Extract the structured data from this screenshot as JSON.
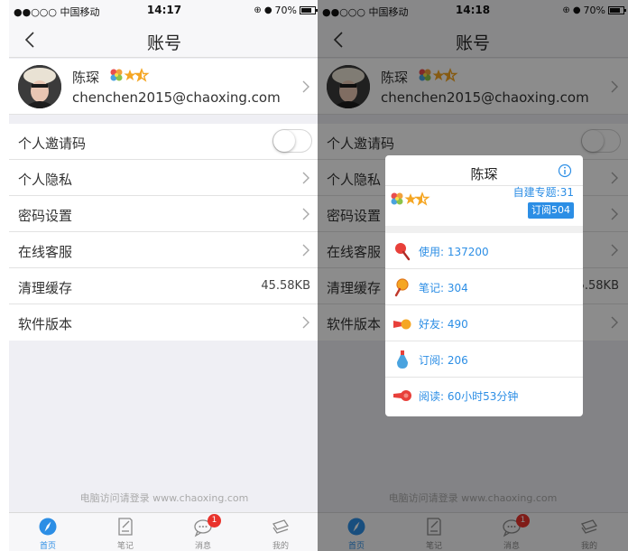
{
  "status_left": {
    "carrier": "●●○○○ 中国移动",
    "time": "14:17",
    "battery": "70%"
  },
  "status_right": {
    "carrier": "●●○○○ 中国移动",
    "time": "14:18",
    "battery": "70%"
  },
  "nav": {
    "title": "账号",
    "back_icon": "chevron-left-icon"
  },
  "profile": {
    "name": "陈琛",
    "email": "chenchen2015@chaoxing.com",
    "badge_icon": "flower-star-badge-icon"
  },
  "settings": [
    {
      "label": "个人邀请码",
      "control": "toggle",
      "toggle_on": false
    },
    {
      "label": "个人隐私",
      "control": "chevron"
    },
    {
      "label": "密码设置",
      "control": "chevron"
    },
    {
      "label": "在线客服",
      "control": "chevron"
    },
    {
      "label": "清理缓存",
      "control": "value",
      "value": "45.58KB"
    },
    {
      "label": "软件版本",
      "control": "chevron"
    }
  ],
  "footer": {
    "text": "电脑访问请登录 www.chaoxing.com"
  },
  "tabbar": {
    "active": "首页",
    "tabs": [
      {
        "label": "首页",
        "icon": "compass-icon"
      },
      {
        "label": "笔记",
        "icon": "note-icon"
      },
      {
        "label": "消息",
        "icon": "chat-icon",
        "badge": "1"
      },
      {
        "label": "我的",
        "icon": "stack-icon"
      }
    ]
  },
  "popup": {
    "name": "陈琛",
    "topics": "自建专题:31",
    "subscribe_button": "订阅504",
    "stats": [
      {
        "label": "使用: 137200",
        "icon": "red-paddle-icon"
      },
      {
        "label": "笔记: 304",
        "icon": "orange-paddle-icon"
      },
      {
        "label": "好友: 490",
        "icon": "shuttlecock-icon"
      },
      {
        "label": "订阅: 206",
        "icon": "bottle-icon"
      },
      {
        "label": "阅读: 60小时53分钟",
        "icon": "horn-icon"
      }
    ]
  },
  "colors": {
    "accent_blue": "#2c8ee5",
    "badge_red": "#e9332c",
    "page_background": "#efeff4",
    "overlay": "rgba(0,0,0,0.45)"
  }
}
